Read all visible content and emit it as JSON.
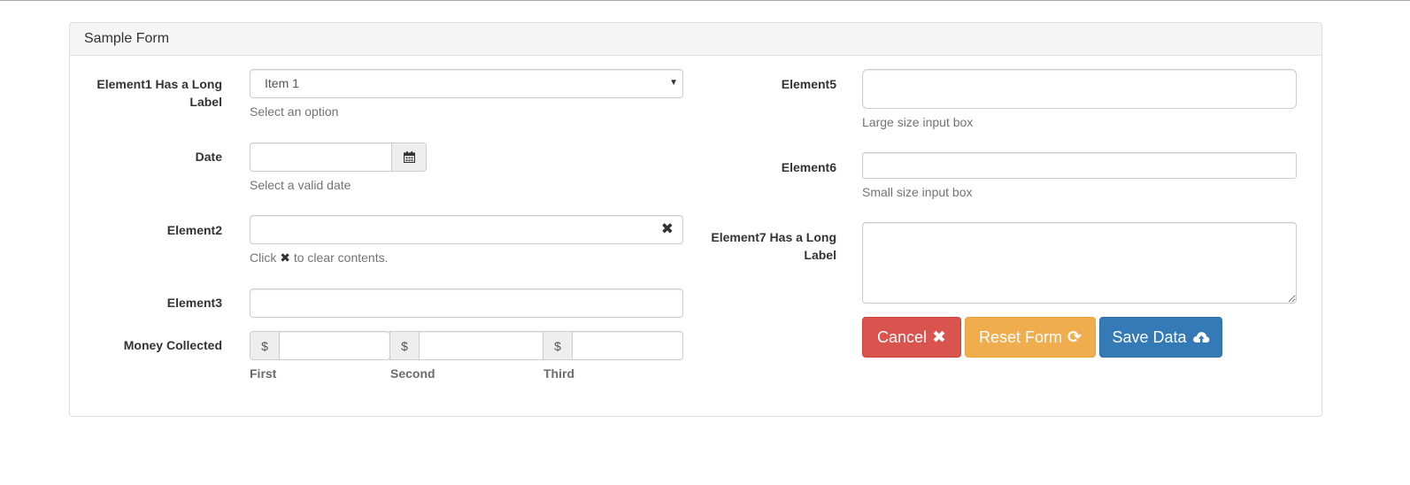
{
  "panel": {
    "title": "Sample Form"
  },
  "left": {
    "element1": {
      "label": "Element1 Has a Long Label",
      "value": "Item 1",
      "help": "Select an option"
    },
    "date": {
      "label": "Date",
      "value": "",
      "help": "Select a valid date",
      "icon": "calendar-icon"
    },
    "element2": {
      "label": "Element2",
      "value": "",
      "help_prefix": "Click",
      "help_icon": "✖",
      "help_suffix": "to clear contents.",
      "clear_icon": "✖"
    },
    "element3": {
      "label": "Element3",
      "value": ""
    },
    "money": {
      "label": "Money Collected",
      "currency_symbol": "$",
      "fields": [
        {
          "sublabel": "First",
          "value": ""
        },
        {
          "sublabel": "Second",
          "value": ""
        },
        {
          "sublabel": "Third",
          "value": ""
        }
      ]
    }
  },
  "right": {
    "element5": {
      "label": "Element5",
      "value": "",
      "help": "Large size input box"
    },
    "element6": {
      "label": "Element6",
      "value": "",
      "help": "Small size input box"
    },
    "element7": {
      "label": "Element7 Has a Long Label",
      "value": ""
    }
  },
  "buttons": {
    "cancel": {
      "label": "Cancel",
      "icon": "✖",
      "color": "#d9534f"
    },
    "reset": {
      "label": "Reset Form",
      "icon": "⟳",
      "color": "#f0ad4e"
    },
    "save": {
      "label": "Save Data",
      "icon": "cloud-upload-icon",
      "color": "#337ab7"
    }
  }
}
